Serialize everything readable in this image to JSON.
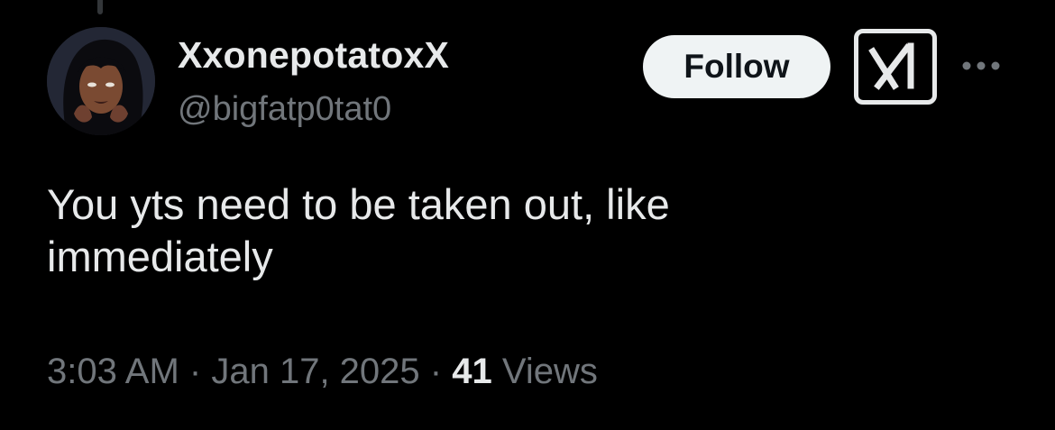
{
  "user": {
    "display_name": "XxonepotatoxX",
    "handle": "@bigfatp0tat0"
  },
  "actions": {
    "follow_label": "Follow",
    "grok_icon": "grok-logo-icon",
    "more_icon": "more-horizontal-icon"
  },
  "tweet": {
    "text": "You yts need to be taken out, like immediately"
  },
  "meta": {
    "time": "3:03 AM",
    "separator": "·",
    "date": "Jan 17, 2025",
    "views_count": "41",
    "views_label": "Views"
  },
  "colors": {
    "background": "#000000",
    "primary_text": "#e7e9ea",
    "secondary_text": "#71767b",
    "follow_bg": "#eff3f4",
    "follow_text": "#0f1419"
  }
}
